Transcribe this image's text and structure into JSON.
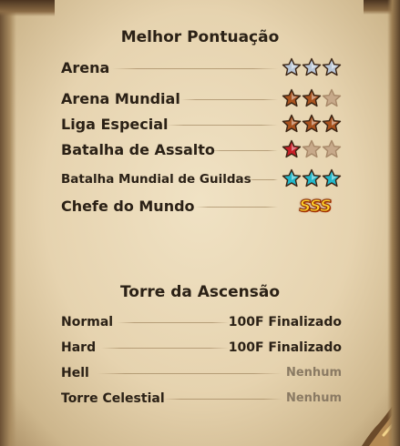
{
  "best_score": {
    "title": "Melhor Pontuação",
    "rows": [
      {
        "label": "Arena",
        "stars_filled": 3,
        "stars_total": 3,
        "tier": "silver"
      },
      {
        "label": "Arena Mundial",
        "stars_filled": 2,
        "stars_total": 3,
        "tier": "bronze"
      },
      {
        "label": "Liga Especial",
        "stars_filled": 3,
        "stars_total": 3,
        "tier": "bronze"
      },
      {
        "label": "Batalha de Assalto",
        "stars_filled": 1,
        "stars_total": 3,
        "tier": "red"
      },
      {
        "label": "Batalha Mundial de Guildas",
        "stars_filled": 3,
        "stars_total": 3,
        "tier": "cyan"
      },
      {
        "label": "Chefe do Mundo",
        "rank": "SSS"
      }
    ]
  },
  "ascension_tower": {
    "title": "Torre da Ascensão",
    "rows": [
      {
        "label": "Normal",
        "value": "100F Finalizado"
      },
      {
        "label": "Hard",
        "value": "100F Finalizado"
      },
      {
        "label": "Hell",
        "value": "Nenhum"
      },
      {
        "label": "Torre Celestial",
        "value": "Nenhum"
      }
    ]
  },
  "colors": {
    "text_dark": "#2b2116",
    "value_dark": "#2b2116",
    "value_muted": "#8a7a63",
    "star_silver": "#b9c6d6",
    "star_bronze": "#a8521e",
    "star_red": "#c81e28",
    "star_cyan": "#22b7c9",
    "star_empty": "#c7a98a"
  }
}
